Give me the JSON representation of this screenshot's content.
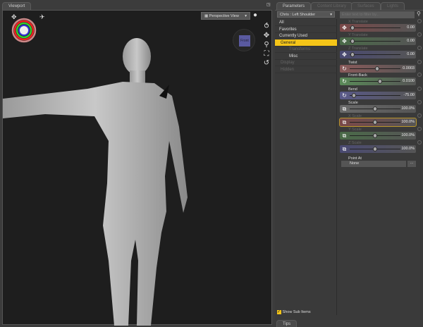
{
  "viewport": {
    "tab": "Viewport",
    "view_select": "Perspective View",
    "cube_label": "Front"
  },
  "panel": {
    "tabs": [
      "Parameters",
      "Content Library",
      "Surfaces",
      "Lights"
    ],
    "node_select": "Chris : Left Shoulder",
    "filter_placeholder": "Enter text to filter by...",
    "categories": [
      {
        "label": "All",
        "dim": false
      },
      {
        "label": "Favorites",
        "dim": false
      },
      {
        "label": "Currently Used",
        "dim": false
      },
      {
        "label": "General",
        "dim": false,
        "selected": true
      },
      {
        "label": "Transforms",
        "dim": true
      },
      {
        "label": "Misc",
        "dim": false
      },
      {
        "label": "Display",
        "dim": true
      },
      {
        "label": "Hidden",
        "dim": true
      }
    ],
    "show_sub_items": "Show Sub Items",
    "show_sub_items_checked": true,
    "params": [
      {
        "label": "X Translate",
        "value": "0.00",
        "dim": true,
        "color": "#7a4848",
        "icon": "move-icon",
        "pos": 0.02
      },
      {
        "label": "Y Translate",
        "value": "0.00",
        "dim": true,
        "color": "#4a6a48",
        "icon": "move-icon",
        "pos": 0.02
      },
      {
        "label": "Z Translate",
        "value": "0.00",
        "dim": true,
        "color": "#4a4a72",
        "icon": "move-icon",
        "pos": 0.02
      },
      {
        "label": "Twist",
        "value": "0.0003",
        "dim": false,
        "color": "#8a5a5a",
        "icon": "rotate-icon",
        "pos": 0.55
      },
      {
        "label": "Front-Back",
        "value": "0.0100",
        "dim": false,
        "color": "#5a8a58",
        "icon": "rotate-icon",
        "pos": 0.6
      },
      {
        "label": "Bend",
        "value": "-75.00",
        "dim": false,
        "color": "#5a5a8a",
        "icon": "rotate-icon",
        "pos": 0.05
      },
      {
        "label": "Scale",
        "value": "100.0%",
        "dim": false,
        "color": "#6a6a6a",
        "icon": "scale-icon",
        "pos": 0.5
      },
      {
        "label": "X Scale",
        "value": "100.0%",
        "dim": true,
        "color": "#7a4848",
        "icon": "scale-icon",
        "pos": 0.5
      },
      {
        "label": "Y Scale",
        "value": "100.0%",
        "dim": true,
        "color": "#4a6a48",
        "icon": "scale-icon",
        "pos": 0.5
      },
      {
        "label": "Z Scale",
        "value": "100.0%",
        "dim": true,
        "color": "#4a4a72",
        "icon": "scale-icon",
        "pos": 0.5
      }
    ],
    "point_at": {
      "label": "Point At",
      "value": "None",
      "button": "..."
    },
    "tips_tab": "Tips"
  },
  "colors": {
    "selected": "#f5c518",
    "viewport_bg": "#1e1e1e"
  }
}
